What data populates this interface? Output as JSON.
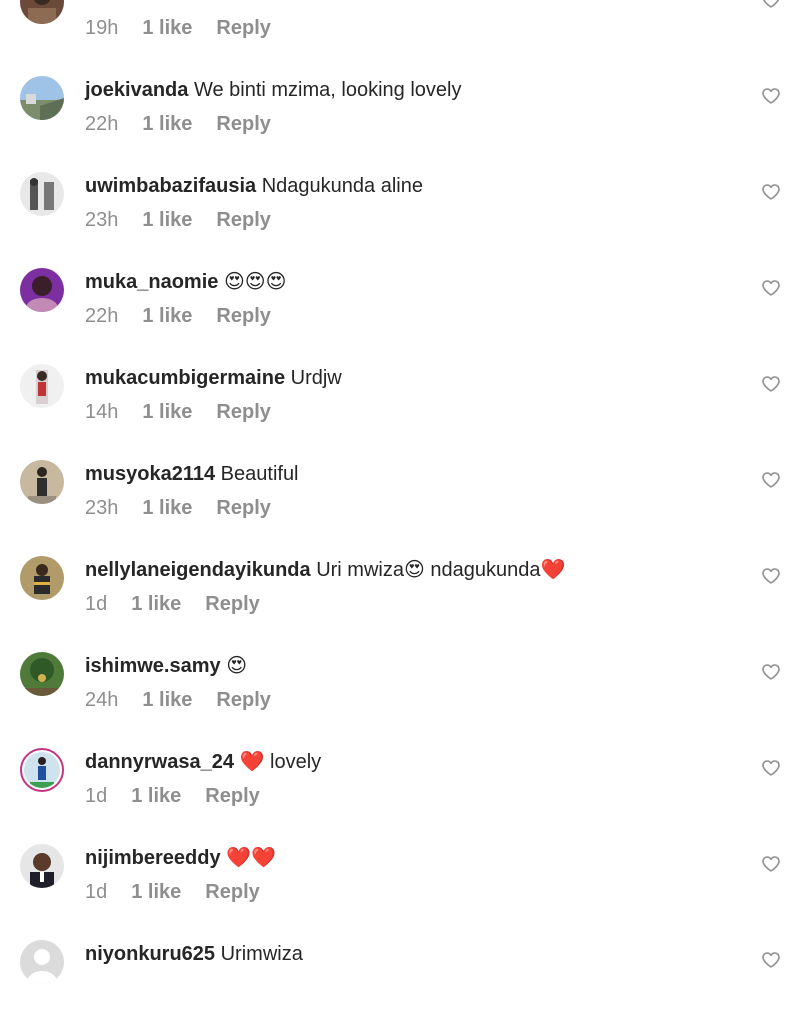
{
  "comments": [
    {
      "user": "",
      "text": "",
      "time": "19h",
      "likes": "1 like",
      "reply": "Reply",
      "avatar": "avatar-1",
      "story": false
    },
    {
      "user": "joekivanda",
      "text": "We binti mzima, looking lovely",
      "time": "22h",
      "likes": "1 like",
      "reply": "Reply",
      "avatar": "avatar-2",
      "story": false
    },
    {
      "user": "uwimbabazifausia",
      "text": "Ndagukunda aline",
      "time": "23h",
      "likes": "1 like",
      "reply": "Reply",
      "avatar": "avatar-3",
      "story": false
    },
    {
      "user": "muka_naomie",
      "text": "😍😍😍",
      "time": "22h",
      "likes": "1 like",
      "reply": "Reply",
      "avatar": "avatar-4",
      "story": false
    },
    {
      "user": "mukacumbigermaine",
      "text": "Urdjw",
      "time": "14h",
      "likes": "1 like",
      "reply": "Reply",
      "avatar": "avatar-5",
      "story": false
    },
    {
      "user": "musyoka2114",
      "text": "Beautiful",
      "time": "23h",
      "likes": "1 like",
      "reply": "Reply",
      "avatar": "avatar-6",
      "story": false
    },
    {
      "user": "nellylaneigendayikunda",
      "text": "Uri mwiza😍 ndagukunda❤️",
      "time": "1d",
      "likes": "1 like",
      "reply": "Reply",
      "avatar": "avatar-7",
      "story": false
    },
    {
      "user": "ishimwe.samy",
      "text": "😍",
      "time": "24h",
      "likes": "1 like",
      "reply": "Reply",
      "avatar": "avatar-8",
      "story": false
    },
    {
      "user": "dannyrwasa_24",
      "text": "❤️ lovely",
      "time": "1d",
      "likes": "1 like",
      "reply": "Reply",
      "avatar": "avatar-9",
      "story": true
    },
    {
      "user": "nijimbereeddy",
      "text": "❤️❤️",
      "time": "1d",
      "likes": "1 like",
      "reply": "Reply",
      "avatar": "avatar-10",
      "story": false
    },
    {
      "user": "niyonkuru625",
      "text": "Urimwiza",
      "time": "",
      "likes": "",
      "reply": "",
      "avatar": "default-avatar",
      "story": false
    }
  ],
  "icons": {
    "like": "heart-outline-icon"
  },
  "colors": {
    "username": "#262626",
    "meta": "#8e8e8e",
    "heart_stroke": "#8e8e8e",
    "story_ring": "#c13584"
  }
}
